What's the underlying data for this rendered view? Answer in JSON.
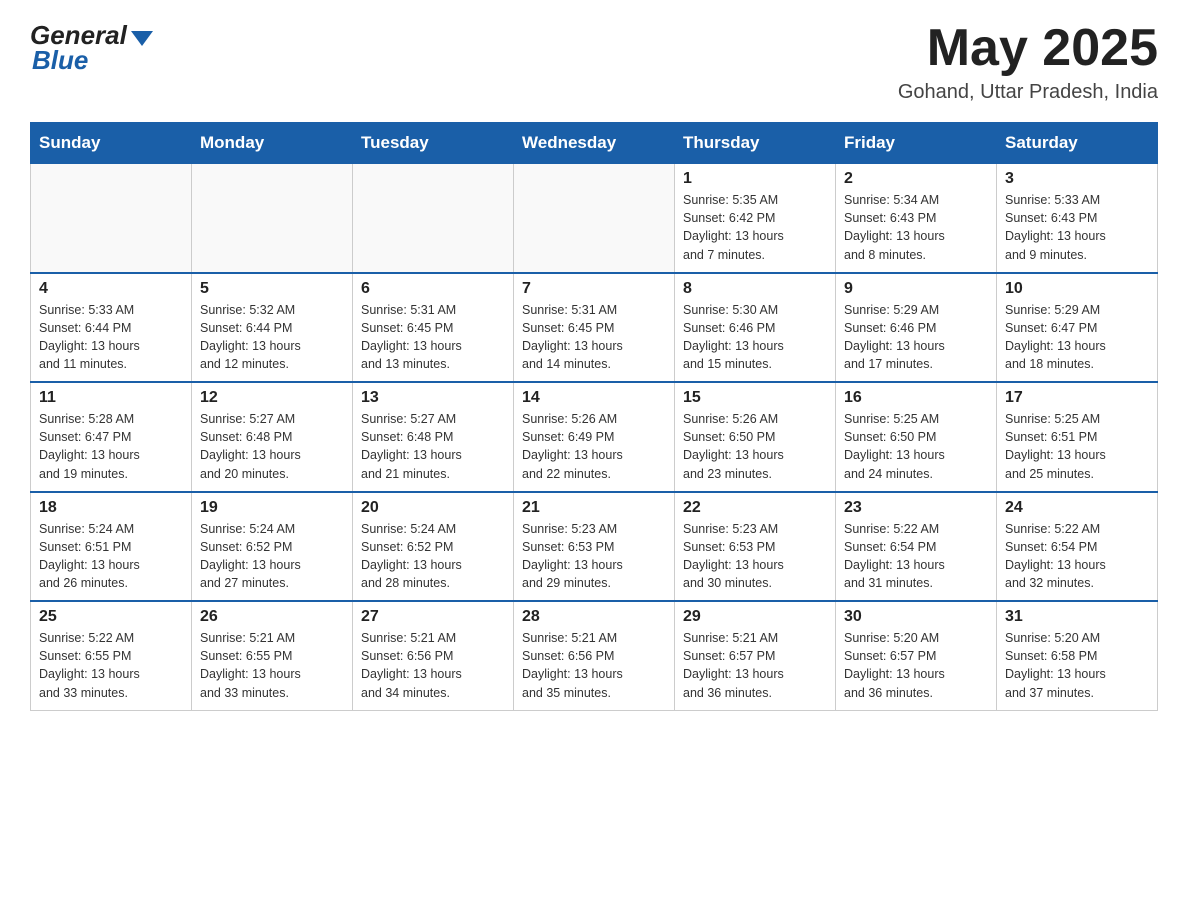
{
  "header": {
    "month_title": "May 2025",
    "location": "Gohand, Uttar Pradesh, India",
    "logo_general": "General",
    "logo_blue": "Blue"
  },
  "weekdays": [
    "Sunday",
    "Monday",
    "Tuesday",
    "Wednesday",
    "Thursday",
    "Friday",
    "Saturday"
  ],
  "weeks": [
    [
      {
        "day": "",
        "info": ""
      },
      {
        "day": "",
        "info": ""
      },
      {
        "day": "",
        "info": ""
      },
      {
        "day": "",
        "info": ""
      },
      {
        "day": "1",
        "info": "Sunrise: 5:35 AM\nSunset: 6:42 PM\nDaylight: 13 hours\nand 7 minutes."
      },
      {
        "day": "2",
        "info": "Sunrise: 5:34 AM\nSunset: 6:43 PM\nDaylight: 13 hours\nand 8 minutes."
      },
      {
        "day": "3",
        "info": "Sunrise: 5:33 AM\nSunset: 6:43 PM\nDaylight: 13 hours\nand 9 minutes."
      }
    ],
    [
      {
        "day": "4",
        "info": "Sunrise: 5:33 AM\nSunset: 6:44 PM\nDaylight: 13 hours\nand 11 minutes."
      },
      {
        "day": "5",
        "info": "Sunrise: 5:32 AM\nSunset: 6:44 PM\nDaylight: 13 hours\nand 12 minutes."
      },
      {
        "day": "6",
        "info": "Sunrise: 5:31 AM\nSunset: 6:45 PM\nDaylight: 13 hours\nand 13 minutes."
      },
      {
        "day": "7",
        "info": "Sunrise: 5:31 AM\nSunset: 6:45 PM\nDaylight: 13 hours\nand 14 minutes."
      },
      {
        "day": "8",
        "info": "Sunrise: 5:30 AM\nSunset: 6:46 PM\nDaylight: 13 hours\nand 15 minutes."
      },
      {
        "day": "9",
        "info": "Sunrise: 5:29 AM\nSunset: 6:46 PM\nDaylight: 13 hours\nand 17 minutes."
      },
      {
        "day": "10",
        "info": "Sunrise: 5:29 AM\nSunset: 6:47 PM\nDaylight: 13 hours\nand 18 minutes."
      }
    ],
    [
      {
        "day": "11",
        "info": "Sunrise: 5:28 AM\nSunset: 6:47 PM\nDaylight: 13 hours\nand 19 minutes."
      },
      {
        "day": "12",
        "info": "Sunrise: 5:27 AM\nSunset: 6:48 PM\nDaylight: 13 hours\nand 20 minutes."
      },
      {
        "day": "13",
        "info": "Sunrise: 5:27 AM\nSunset: 6:48 PM\nDaylight: 13 hours\nand 21 minutes."
      },
      {
        "day": "14",
        "info": "Sunrise: 5:26 AM\nSunset: 6:49 PM\nDaylight: 13 hours\nand 22 minutes."
      },
      {
        "day": "15",
        "info": "Sunrise: 5:26 AM\nSunset: 6:50 PM\nDaylight: 13 hours\nand 23 minutes."
      },
      {
        "day": "16",
        "info": "Sunrise: 5:25 AM\nSunset: 6:50 PM\nDaylight: 13 hours\nand 24 minutes."
      },
      {
        "day": "17",
        "info": "Sunrise: 5:25 AM\nSunset: 6:51 PM\nDaylight: 13 hours\nand 25 minutes."
      }
    ],
    [
      {
        "day": "18",
        "info": "Sunrise: 5:24 AM\nSunset: 6:51 PM\nDaylight: 13 hours\nand 26 minutes."
      },
      {
        "day": "19",
        "info": "Sunrise: 5:24 AM\nSunset: 6:52 PM\nDaylight: 13 hours\nand 27 minutes."
      },
      {
        "day": "20",
        "info": "Sunrise: 5:24 AM\nSunset: 6:52 PM\nDaylight: 13 hours\nand 28 minutes."
      },
      {
        "day": "21",
        "info": "Sunrise: 5:23 AM\nSunset: 6:53 PM\nDaylight: 13 hours\nand 29 minutes."
      },
      {
        "day": "22",
        "info": "Sunrise: 5:23 AM\nSunset: 6:53 PM\nDaylight: 13 hours\nand 30 minutes."
      },
      {
        "day": "23",
        "info": "Sunrise: 5:22 AM\nSunset: 6:54 PM\nDaylight: 13 hours\nand 31 minutes."
      },
      {
        "day": "24",
        "info": "Sunrise: 5:22 AM\nSunset: 6:54 PM\nDaylight: 13 hours\nand 32 minutes."
      }
    ],
    [
      {
        "day": "25",
        "info": "Sunrise: 5:22 AM\nSunset: 6:55 PM\nDaylight: 13 hours\nand 33 minutes."
      },
      {
        "day": "26",
        "info": "Sunrise: 5:21 AM\nSunset: 6:55 PM\nDaylight: 13 hours\nand 33 minutes."
      },
      {
        "day": "27",
        "info": "Sunrise: 5:21 AM\nSunset: 6:56 PM\nDaylight: 13 hours\nand 34 minutes."
      },
      {
        "day": "28",
        "info": "Sunrise: 5:21 AM\nSunset: 6:56 PM\nDaylight: 13 hours\nand 35 minutes."
      },
      {
        "day": "29",
        "info": "Sunrise: 5:21 AM\nSunset: 6:57 PM\nDaylight: 13 hours\nand 36 minutes."
      },
      {
        "day": "30",
        "info": "Sunrise: 5:20 AM\nSunset: 6:57 PM\nDaylight: 13 hours\nand 36 minutes."
      },
      {
        "day": "31",
        "info": "Sunrise: 5:20 AM\nSunset: 6:58 PM\nDaylight: 13 hours\nand 37 minutes."
      }
    ]
  ]
}
